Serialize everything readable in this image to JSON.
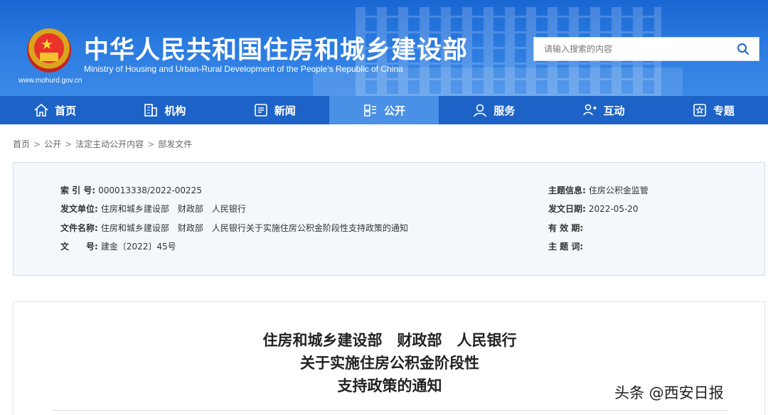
{
  "header": {
    "title_cn": "中华人民共和国住房和城乡建设部",
    "title_en": "Ministry of Housing and Urban-Rural Development of the People’s Republic of China",
    "url": "www.mohurd.gov.cn",
    "emblem_icon": "national-emblem-icon"
  },
  "search": {
    "placeholder": "请输入搜索的内容",
    "icon": "search-icon"
  },
  "nav": {
    "items": [
      {
        "label": "首页",
        "icon": "home-icon"
      },
      {
        "label": "机构",
        "icon": "building-icon"
      },
      {
        "label": "新闻",
        "icon": "news-icon"
      },
      {
        "label": "公开",
        "icon": "disclosure-icon",
        "active": true
      },
      {
        "label": "服务",
        "icon": "service-icon"
      },
      {
        "label": "互动",
        "icon": "interact-icon"
      },
      {
        "label": "专题",
        "icon": "topic-icon"
      }
    ]
  },
  "breadcrumb": [
    "首页",
    "公开",
    "法定主动公开内容",
    "部发文件"
  ],
  "info": {
    "index_label": "索 引 号:",
    "index_value": "000013338/2022-00225",
    "issuer_label": "发文单位:",
    "issuer_value": "住房和城乡建设部　财政部　人民银行",
    "filename_label": "文件名称:",
    "filename_value": "住房和城乡建设部　财政部　人民银行关于实施住房公积金阶段性支持政策的通知",
    "docno_label": "文　　号:",
    "docno_value": "建金〔2022〕45号",
    "subject_label": "主题信息:",
    "subject_value": "住房公积金监管",
    "date_label": "发文日期:",
    "date_value": "2022-05-20",
    "validity_label": "有 效 期:",
    "validity_value": "",
    "keywords_label": "主 题 词:",
    "keywords_value": ""
  },
  "document": {
    "title_line1": "住房和城乡建设部　财政部　人民银行",
    "title_line2": "关于实施住房公积金阶段性",
    "title_line3": "支持政策的通知"
  },
  "watermark": "头条 @西安日报",
  "colors": {
    "nav": "#1d63c7",
    "nav_active": "#4a90e6",
    "header": "#2a7ae0"
  }
}
